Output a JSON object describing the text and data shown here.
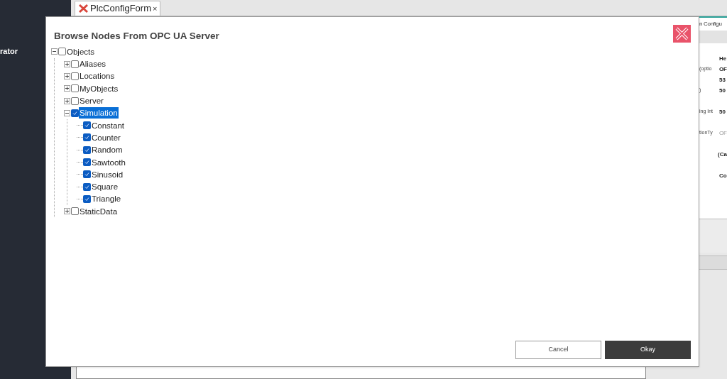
{
  "sidebar": {
    "label": "rator"
  },
  "tabs": [
    {
      "label": "PlcConfigForm",
      "close": "×",
      "selected": true
    }
  ],
  "right_panel": {
    "tab": "n Configu",
    "rows": [
      {
        "label": "",
        "value": "He",
        "muted": false
      },
      {
        "label": "(optio",
        "value": "OF",
        "muted": false
      },
      {
        "label": "",
        "value": "53",
        "muted": false
      },
      {
        "label": ")",
        "value": "50",
        "muted": false
      },
      {
        "label": "ing Int",
        "value": "50",
        "muted": false
      },
      {
        "label": "tionTy",
        "value": "OF",
        "muted": true
      },
      {
        "label": "",
        "value": "(Ca",
        "muted": false
      },
      {
        "label": "",
        "value": "Co",
        "muted": false
      }
    ]
  },
  "dialog": {
    "title": "Browse Nodes From OPC UA Server",
    "tree": [
      {
        "label": "Objects",
        "checked": false,
        "selected": false,
        "expanded": true,
        "children": [
          {
            "label": "Aliases",
            "checked": false,
            "selected": false,
            "expanded": false
          },
          {
            "label": "Locations",
            "checked": false,
            "selected": false,
            "expanded": false
          },
          {
            "label": "MyObjects",
            "checked": false,
            "selected": false,
            "expanded": false
          },
          {
            "label": "Server",
            "checked": false,
            "selected": false,
            "expanded": false
          },
          {
            "label": "Simulation",
            "checked": true,
            "selected": true,
            "expanded": true,
            "children": [
              {
                "label": "Constant",
                "checked": true,
                "selected": false
              },
              {
                "label": "Counter",
                "checked": true,
                "selected": false
              },
              {
                "label": "Random",
                "checked": true,
                "selected": false
              },
              {
                "label": "Sawtooth",
                "checked": true,
                "selected": false
              },
              {
                "label": "Sinusoid",
                "checked": true,
                "selected": false
              },
              {
                "label": "Square",
                "checked": true,
                "selected": false
              },
              {
                "label": "Triangle",
                "checked": true,
                "selected": false
              }
            ]
          },
          {
            "label": "StaticData",
            "checked": false,
            "selected": false,
            "expanded": false
          }
        ]
      }
    ],
    "buttons": [
      {
        "label": "Cancel",
        "kind": "secondary"
      },
      {
        "label": "Okay",
        "kind": "primary"
      }
    ]
  }
}
